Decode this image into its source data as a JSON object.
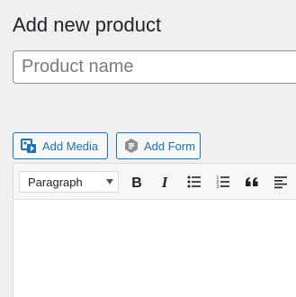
{
  "page": {
    "title": "Add new product"
  },
  "product_name": {
    "placeholder": "Product name",
    "value": ""
  },
  "media_buttons": {
    "add_media_label": "Add Media",
    "add_form_label": "Add Form"
  },
  "toolbar": {
    "format_select_value": "Paragraph",
    "buttons": [
      {
        "name": "bold",
        "icon": "bold-icon"
      },
      {
        "name": "italic",
        "icon": "italic-icon"
      },
      {
        "name": "bulleted-list",
        "icon": "bulleted-list-icon"
      },
      {
        "name": "numbered-list",
        "icon": "numbered-list-icon"
      },
      {
        "name": "blockquote",
        "icon": "blockquote-icon"
      },
      {
        "name": "align-left",
        "icon": "align-left-icon"
      }
    ]
  },
  "colors": {
    "accent": "#2271b1",
    "background": "#f0f0f1",
    "text": "#1d2327"
  }
}
